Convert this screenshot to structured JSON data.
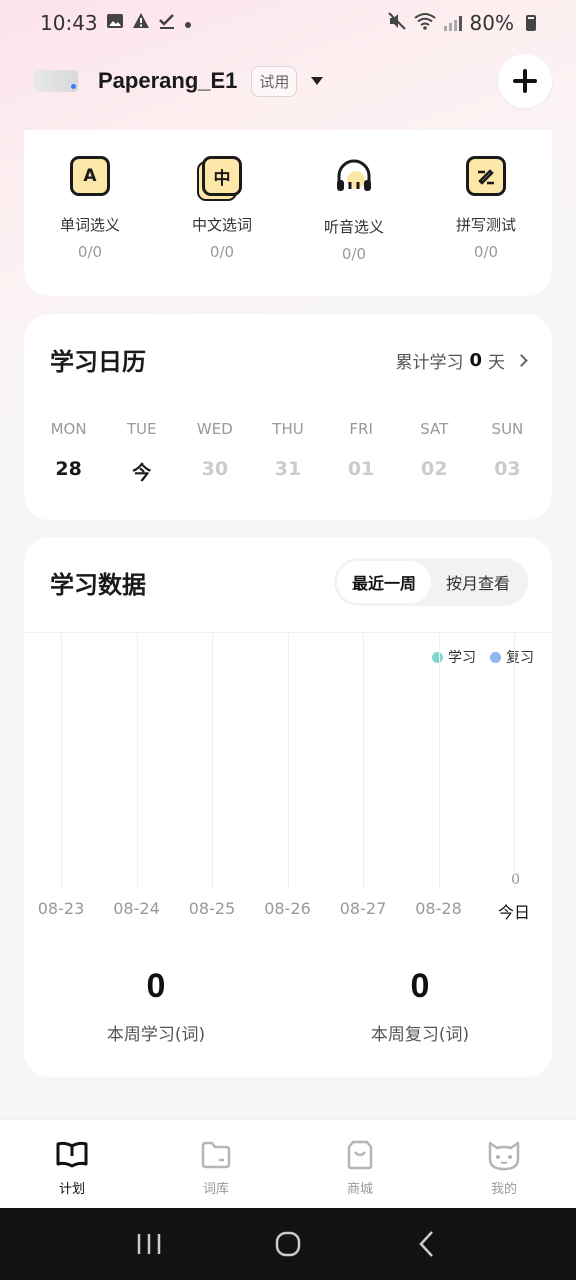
{
  "status_bar": {
    "time": "10:43",
    "battery": "80%"
  },
  "header": {
    "device_name": "Paperang_E1",
    "badge": "试用"
  },
  "practice_modes": [
    {
      "icon": "letter-a-icon",
      "glyph": "A",
      "label": "单词选义",
      "count": "0/0"
    },
    {
      "icon": "chinese-char-icon",
      "glyph": "中",
      "label": "中文选词",
      "count": "0/0"
    },
    {
      "icon": "headphones-icon",
      "glyph": "",
      "label": "听音选义",
      "count": "0/0"
    },
    {
      "icon": "pencil-edit-icon",
      "glyph": "",
      "label": "拼写测试",
      "count": "0/0"
    }
  ],
  "calendar": {
    "title": "学习日历",
    "total_prefix": "累计学习",
    "total_days": "0",
    "total_suffix": "天",
    "days": [
      {
        "name": "MON",
        "date": "28",
        "active": true
      },
      {
        "name": "TUE",
        "date": "今",
        "active": true
      },
      {
        "name": "WED",
        "date": "30",
        "active": false
      },
      {
        "name": "THU",
        "date": "31",
        "active": false
      },
      {
        "name": "FRI",
        "date": "01",
        "active": false
      },
      {
        "name": "SAT",
        "date": "02",
        "active": false
      },
      {
        "name": "SUN",
        "date": "03",
        "active": false
      }
    ]
  },
  "study_data": {
    "title": "学习数据",
    "tabs": [
      "最近一周",
      "按月查看"
    ],
    "active_tab": 0,
    "stats": [
      {
        "value": "0",
        "label": "本周学习(词)"
      },
      {
        "value": "0",
        "label": "本周复习(词)"
      }
    ]
  },
  "chart_data": {
    "type": "bar",
    "categories": [
      "08-23",
      "08-24",
      "08-25",
      "08-26",
      "08-27",
      "08-28",
      "今日"
    ],
    "series": [
      {
        "name": "学习",
        "color": "#7fd8cc",
        "values": [
          0,
          0,
          0,
          0,
          0,
          0,
          0
        ]
      },
      {
        "name": "复习",
        "color": "#8db8f0",
        "values": [
          0,
          0,
          0,
          0,
          0,
          0,
          0
        ]
      }
    ],
    "y_tick_label": "0",
    "legend_placement": "top-right",
    "grid": "vertical"
  },
  "bottom_nav": [
    {
      "label": "计划",
      "icon": "book-icon",
      "active": true
    },
    {
      "label": "词库",
      "icon": "folder-icon",
      "active": false
    },
    {
      "label": "商城",
      "icon": "shopping-bag-icon",
      "active": false
    },
    {
      "label": "我的",
      "icon": "cat-face-icon",
      "active": false
    }
  ]
}
